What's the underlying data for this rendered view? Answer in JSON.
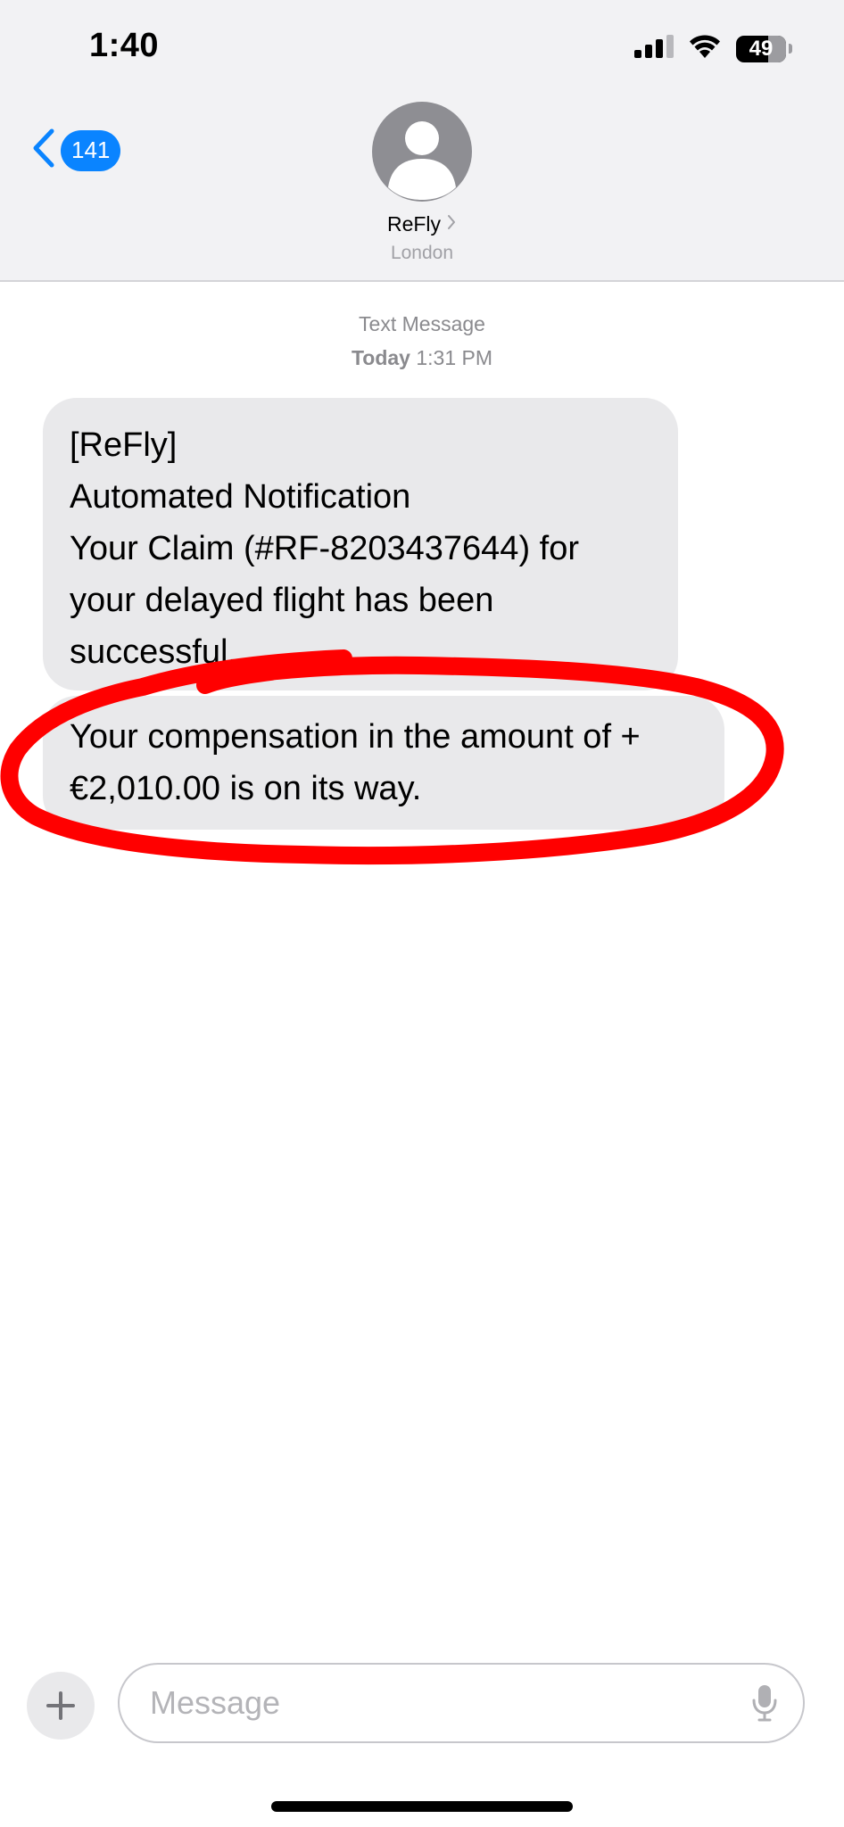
{
  "status_bar": {
    "time": "1:40",
    "battery_level": "49",
    "icons": [
      "cellular-signal-icon",
      "wifi-icon",
      "battery-icon"
    ]
  },
  "header": {
    "back_count": "141",
    "contact_name": "ReFly",
    "contact_location": "London",
    "icons": [
      "chevron-left-icon",
      "person-avatar-icon",
      "chevron-right-icon"
    ]
  },
  "conversation": {
    "message_type": "Text Message",
    "timestamp_day": "Today",
    "timestamp_time": "1:31 PM",
    "messages": [
      {
        "lines": [
          "[ReFly]",
          "Automated Notification",
          "Your Claim (#RF-8203437644) for",
          "your delayed flight has been",
          "successful."
        ]
      },
      {
        "lines": [
          "Your compensation in the amount of +",
          "€2,010.00 is on its way."
        ]
      }
    ]
  },
  "input_bar": {
    "placeholder": "Message",
    "value": "",
    "icons": [
      "plus-icon",
      "microphone-icon"
    ]
  },
  "colors": {
    "accent": "#0a84ff",
    "header_bg": "#f2f2f4",
    "received_bubble": "#e9e9eb",
    "annotation": "#ff0000",
    "secondary_text": "#8a8a8e"
  }
}
